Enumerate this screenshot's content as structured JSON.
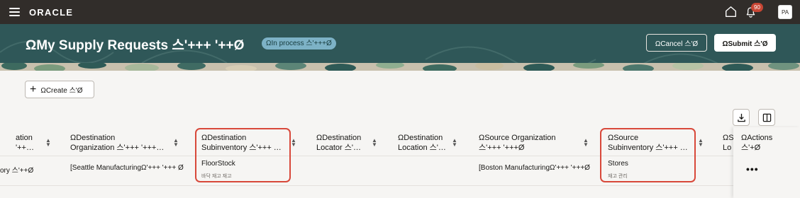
{
  "topbar": {
    "brand": "ORACLE",
    "notification_count": "90",
    "avatar_initials": "PA"
  },
  "header": {
    "title": "ΩMy Supply Requests 스'+++ '++Ø",
    "status": "ΩIn process 스'+++Ø",
    "cancel_label": "ΩCancel 스'Ø",
    "submit_label": "ΩSubmit 스'Ø"
  },
  "toolbar": {
    "create_label": "ΩCreate 스'Ø"
  },
  "table": {
    "columns": [
      {
        "line1": "ation",
        "line2": "'++…"
      },
      {
        "line1": "ΩDestination",
        "line2": "Organization 스'+++ '+++…"
      },
      {
        "line1": "ΩDestination",
        "line2": "Subinventory 스'+++ …"
      },
      {
        "line1": "ΩDestination",
        "line2": "Locator 스'…"
      },
      {
        "line1": "ΩDestination",
        "line2": "Location 스'…"
      },
      {
        "line1": "ΩSource Organization",
        "line2": "스'+++ '+++Ø"
      },
      {
        "line1": "ΩSource",
        "line2": "Subinventory 스'+++ …"
      },
      {
        "line1": "ΩS",
        "line2": "Lo"
      },
      {
        "line1": "ΩActions",
        "line2": "스'+Ø"
      }
    ],
    "row": {
      "col0": "ory 스'++Ø",
      "destination_org": "[Seattle ManufacturingΩ'+++ '+++ Ø",
      "destination_subinventory": "FloorStock",
      "destination_subinventory_desc": "바닥 재고 재고",
      "source_org": "[Boston ManufacturingΩ'+++ '+++Ø",
      "source_subinventory": "Stores",
      "source_subinventory_desc": "재고 관리",
      "actions": "•••"
    }
  },
  "colors": {
    "topbar": "#312d2a",
    "header": "#2f5758",
    "highlight": "#d8483a",
    "badge": "#c74634"
  }
}
